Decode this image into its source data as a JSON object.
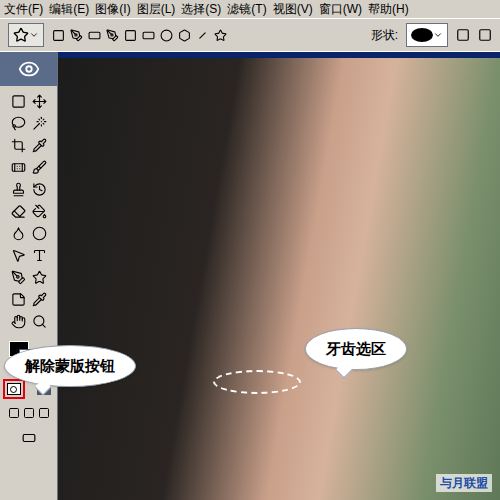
{
  "menu": [
    "文件(F)",
    "编辑(E)",
    "图像(I)",
    "图层(L)",
    "选择(S)",
    "滤镜(T)",
    "视图(V)",
    "窗口(W)",
    "帮助(H)"
  ],
  "options_bar": {
    "shape_label": "形状:"
  },
  "mask_modes": [
    {
      "kind": "standard",
      "highlighted": true
    },
    {
      "kind": "quickmask",
      "highlighted": false
    }
  ],
  "document": {
    "selection_visible": true
  },
  "annotations": [
    {
      "text": "解除蒙版按钮"
    },
    {
      "text": "牙齿选区"
    }
  ],
  "watermark": "与月联盟"
}
